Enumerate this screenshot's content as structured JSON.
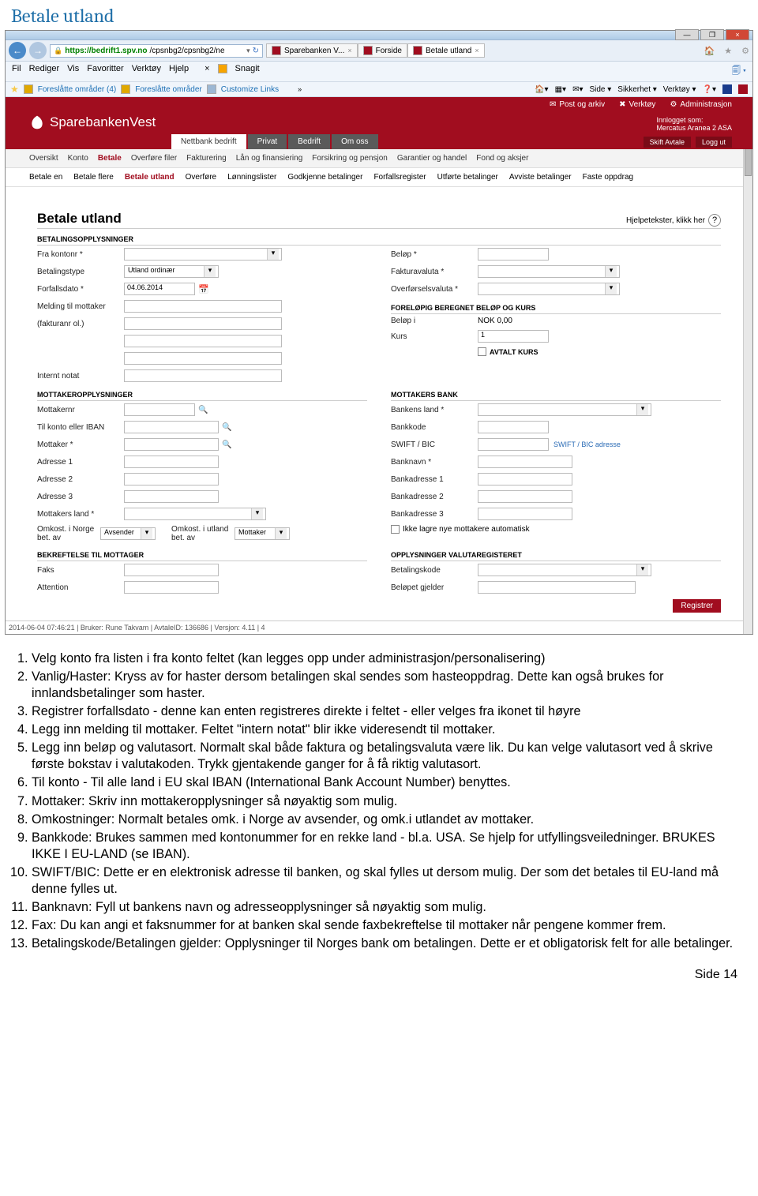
{
  "page_title": "Betale utland",
  "browser": {
    "url_host": "https://bedrift1.spv.no",
    "url_path": "/cpsnbg2/cpsnbg2/ne",
    "tabs": [
      {
        "icon": "spv",
        "label": "Sparebanken V...",
        "close": "×"
      },
      {
        "icon": "page",
        "label": "Forside",
        "close": ""
      },
      {
        "icon": "page",
        "label": "Betale utland",
        "close": "×"
      }
    ],
    "title_icons": [
      "🏠",
      "★",
      "⚙"
    ],
    "menus": [
      "Fil",
      "Rediger",
      "Vis",
      "Favoritter",
      "Verktøy",
      "Hjelp"
    ],
    "snagit_label": "Snagit",
    "fav_links": [
      "Foreslåtte områder (4)",
      "Foreslåtte områder",
      "Customize Links"
    ],
    "toolbar_right": [
      "Side",
      "Sikkerhet",
      "Verktøy"
    ]
  },
  "bank": {
    "logo": "SparebankenVest",
    "header_links": [
      {
        "icon": "✉",
        "label": "Post og arkiv"
      },
      {
        "icon": "✖",
        "label": "Verktøy"
      },
      {
        "icon": "⚙",
        "label": "Administrasjon"
      }
    ],
    "login_label": "Innlogget som:",
    "login_name": "Mercatus Aranea 2 ASA",
    "red_buttons": [
      "Skift Avtale",
      "Logg ut"
    ],
    "main_tabs": [
      "Nettbank bedrift",
      "Privat",
      "Bedrift",
      "Om oss"
    ],
    "subnav": [
      "Oversikt",
      "Konto",
      "Betale",
      "Overføre filer",
      "Fakturering",
      "Lån og finansiering",
      "Forsikring og pensjon",
      "Garantier og handel",
      "Fond og aksjer"
    ],
    "subnav2": [
      "Betale en",
      "Betale flere",
      "Betale utland",
      "Overføre",
      "Lønningslister",
      "Godkjenne betalinger",
      "Forfallsregister",
      "Utførte betalinger",
      "Avviste betalinger",
      "Faste oppdrag"
    ]
  },
  "form": {
    "title": "Betale utland",
    "help": "Hjelpetekster, klikk her",
    "sections": {
      "s1": "BETALINGSOPPLYSNINGER",
      "s2": "FORELØPIG BEREGNET BELØP OG KURS",
      "s3": "MOTTAKEROPPLYSNINGER",
      "s3b": "MOTTAKERS BANK",
      "s4": "BEKREFTELSE TIL MOTTAGER",
      "s4b": "OPPLYSNINGER VALUTAREGISTERET"
    },
    "labels": {
      "fra_konto": "Fra kontonr *",
      "betalingstype": "Betalingstype",
      "betalingstype_val": "Utland ordinær",
      "forfall": "Forfallsdato *",
      "forfall_val": "04.06.2014",
      "melding": "Melding til mottaker",
      "fakturanr": "(fakturanr ol.)",
      "internt": "Internt notat",
      "belop": "Beløp *",
      "fvaluta": "Fakturavaluta *",
      "ovaluta": "Overførselsvaluta *",
      "belop_i": "Beløp i",
      "belop_i_val": "NOK 0,00",
      "kurs": "Kurs",
      "kurs_val": "1",
      "avtalt_kurs": "AVTALT KURS",
      "mottakernr": "Mottakernr",
      "tilkonto": "Til konto eller IBAN",
      "mottaker": "Mottaker *",
      "adr1": "Adresse 1",
      "adr2": "Adresse 2",
      "adr3": "Adresse 3",
      "mland": "Mottakers land *",
      "omk_n": "Omkost. i Norge bet. av",
      "omk_n_val": "Avsender",
      "omk_u": "Omkost. i utland bet. av",
      "omk_u_val": "Mottaker",
      "bland": "Bankens land *",
      "bkode": "Bankkode",
      "swift": "SWIFT / BIC",
      "swift_link": "SWIFT / BIC adresse",
      "bnavn": "Banknavn *",
      "badr1": "Bankadresse 1",
      "badr2": "Bankadresse 2",
      "badr3": "Bankadresse 3",
      "ikke_lagre": "Ikke lagre nye mottakere automatisk",
      "faks": "Faks",
      "attention": "Attention",
      "bet_kode": "Betalingskode",
      "bet_gjelder": "Beløpet gjelder"
    },
    "register_btn": "Registrer",
    "status": "2014-06-04 07:46:21 | Bruker: Rune Takvam | AvtaleID: 136686 | Versjon: 4.11 | 4"
  },
  "instructions": [
    "Velg konto fra listen i fra konto feltet (kan legges opp under administrasjon/personalisering)",
    "Vanlig/Haster: Kryss av for haster dersom betalingen skal sendes som hasteoppdrag. Dette kan også brukes for innlandsbetalinger som haster.",
    "Registrer forfallsdato - denne kan enten registreres direkte i feltet - eller velges fra ikonet til høyre",
    "Legg inn melding til mottaker. Feltet \"intern notat\" blir ikke videresendt til mottaker.",
    "Legg inn beløp og valutasort. Normalt skal både faktura og betalingsvaluta være lik. Du kan velge valutasort ved å skrive første bokstav i valutakoden. Trykk gjentakende ganger for å få riktig valutasort.",
    "Til konto - Til alle land i EU skal IBAN (International Bank Account Number) benyttes.",
    "Mottaker: Skriv inn mottakeropplysninger så nøyaktig som mulig.",
    "Omkostninger: Normalt betales omk. i Norge av avsender, og omk.i utlandet av mottaker.",
    "Bankkode: Brukes sammen med kontonummer for en rekke land - bl.a. USA. Se hjelp for utfyllingsveiledninger. BRUKES IKKE I EU-LAND (se IBAN).",
    "SWIFT/BIC: Dette er en elektronisk adresse til banken, og skal fylles ut dersom mulig. Der som det betales til EU-land må denne fylles ut.",
    "Banknavn: Fyll ut bankens navn og adresseopplysninger så nøyaktig som mulig.",
    "Fax: Du kan angi et faksnummer for at banken skal sende faxbekreftelse til mottaker når pengene kommer frem.",
    "Betalingskode/Betalingen gjelder: Opplysninger til Norges bank om betalingen. Dette er et obligatorisk felt for alle betalinger."
  ],
  "footer": "Side 14"
}
